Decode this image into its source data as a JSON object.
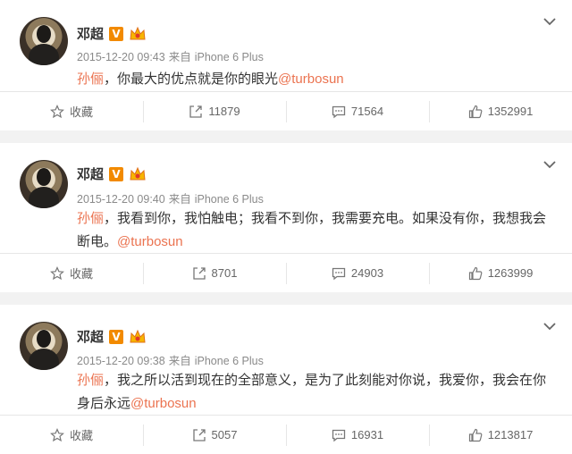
{
  "posts": [
    {
      "name": "邓超",
      "verified_badge": "V",
      "timestamp": "2015-12-20 09:43",
      "source_prefix": "来自",
      "device": "iPhone 6 Plus",
      "mention_name": "孙俪",
      "body": "，你最大的优点就是你的眼光",
      "at_user": "@turbosun",
      "actions": {
        "favorite": "收藏",
        "repost": "11879",
        "comment": "71564",
        "like": "1352991"
      }
    },
    {
      "name": "邓超",
      "verified_badge": "V",
      "timestamp": "2015-12-20 09:40",
      "source_prefix": "来自",
      "device": "iPhone 6 Plus",
      "mention_name": "孙俪",
      "body": "，我看到你，我怕触电；我看不到你，我需要充电。如果没有你，我想我会断电。",
      "at_user": "@turbosun",
      "actions": {
        "favorite": "收藏",
        "repost": "8701",
        "comment": "24903",
        "like": "1263999"
      }
    },
    {
      "name": "邓超",
      "verified_badge": "V",
      "timestamp": "2015-12-20 09:38",
      "source_prefix": "来自",
      "device": "iPhone 6 Plus",
      "mention_name": "孙俪",
      "body": "，我之所以活到现在的全部意义，是为了此刻能对你说，我爱你，我会在你身后永远",
      "at_user": "@turbosun",
      "actions": {
        "favorite": "收藏",
        "repost": "5057",
        "comment": "16931",
        "like": "1213817"
      }
    }
  ],
  "colors": {
    "accent": "#eb7350",
    "verified": "#f28a00",
    "text": "#333333",
    "meta": "#8a8a8a"
  },
  "icons": [
    "star-icon",
    "repost-icon",
    "comment-icon",
    "thumbs-up-icon",
    "chevron-down-icon",
    "vip-crown-icon"
  ]
}
